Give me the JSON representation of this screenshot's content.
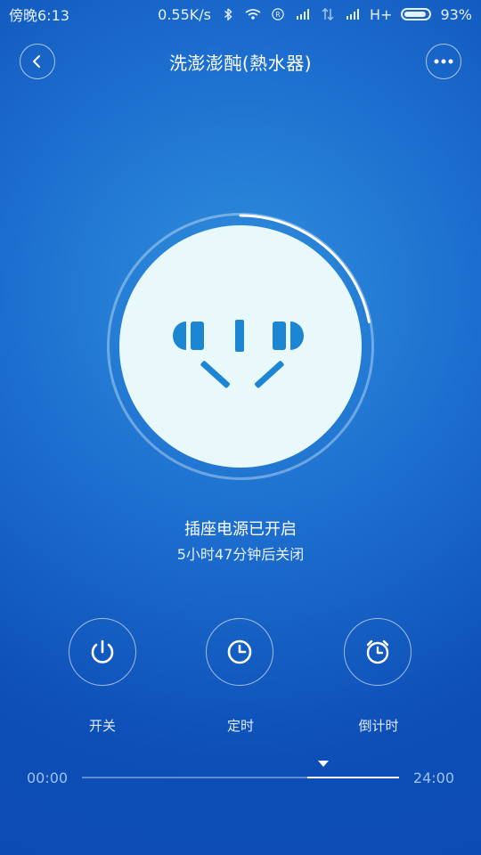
{
  "statusbar": {
    "time": "傍晚6:13",
    "network_speed": "0.55K/s",
    "signal_text": "H+",
    "battery": "93%"
  },
  "header": {
    "title": "洗澎澎䣩(熱水器)",
    "back_icon": "chevron-left-icon",
    "more_icon": "more-dots-icon"
  },
  "dial": {
    "state": "on",
    "progress_fraction": 0.22,
    "icon": "socket-icon"
  },
  "status": {
    "line1": "插座电源已开启",
    "line2": "5小时47分钟后关闭"
  },
  "controls": [
    {
      "label": "开关",
      "icon": "power-icon"
    },
    {
      "label": "定时",
      "icon": "clock-icon"
    },
    {
      "label": "倒计时",
      "icon": "alarm-clock-icon"
    }
  ],
  "timeline": {
    "start": "00:00",
    "end": "24:00",
    "selected_start_fraction": 0.71,
    "selected_end_fraction": 1.0,
    "marker_fraction": 0.76
  }
}
